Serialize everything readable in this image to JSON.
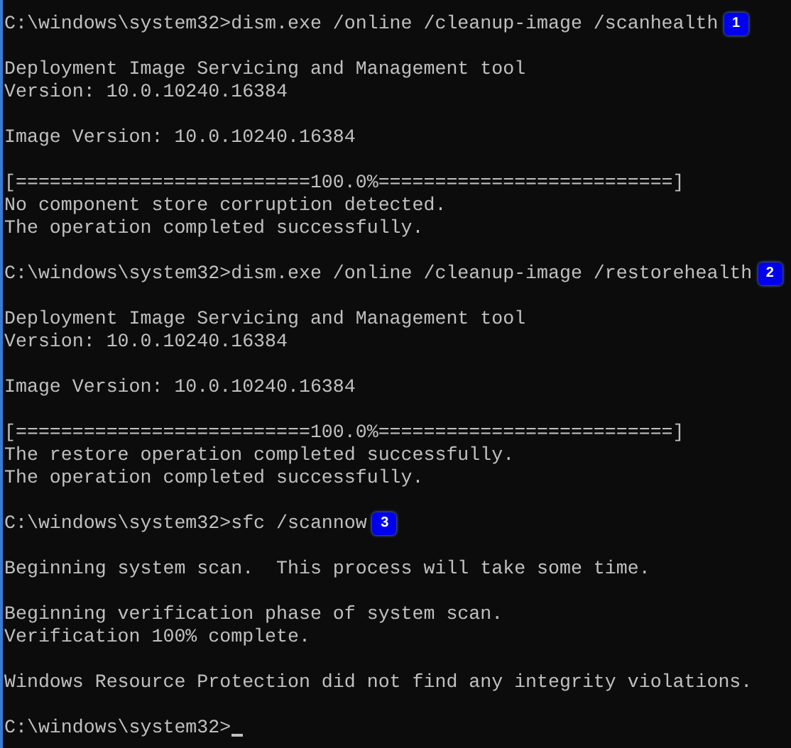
{
  "console": {
    "lines": [
      {
        "kind": "command",
        "text": "C:\\windows\\system32>dism.exe /online /cleanup-image /scanhealth",
        "badge": "1"
      },
      {
        "kind": "blank"
      },
      {
        "kind": "output",
        "text": "Deployment Image Servicing and Management tool"
      },
      {
        "kind": "output",
        "text": "Version: 10.0.10240.16384"
      },
      {
        "kind": "blank"
      },
      {
        "kind": "output",
        "text": "Image Version: 10.0.10240.16384"
      },
      {
        "kind": "blank"
      },
      {
        "kind": "output",
        "text": "[==========================100.0%==========================]"
      },
      {
        "kind": "output",
        "text": "No component store corruption detected."
      },
      {
        "kind": "output",
        "text": "The operation completed successfully."
      },
      {
        "kind": "blank"
      },
      {
        "kind": "command",
        "text": "C:\\windows\\system32>dism.exe /online /cleanup-image /restorehealth",
        "badge": "2"
      },
      {
        "kind": "blank"
      },
      {
        "kind": "output",
        "text": "Deployment Image Servicing and Management tool"
      },
      {
        "kind": "output",
        "text": "Version: 10.0.10240.16384"
      },
      {
        "kind": "blank"
      },
      {
        "kind": "output",
        "text": "Image Version: 10.0.10240.16384"
      },
      {
        "kind": "blank"
      },
      {
        "kind": "output",
        "text": "[==========================100.0%==========================]"
      },
      {
        "kind": "output",
        "text": "The restore operation completed successfully."
      },
      {
        "kind": "output",
        "text": "The operation completed successfully."
      },
      {
        "kind": "blank"
      },
      {
        "kind": "command",
        "text": "C:\\windows\\system32>sfc /scannow",
        "badge": "3"
      },
      {
        "kind": "blank"
      },
      {
        "kind": "output",
        "text": "Beginning system scan.  This process will take some time."
      },
      {
        "kind": "blank"
      },
      {
        "kind": "output",
        "text": "Beginning verification phase of system scan."
      },
      {
        "kind": "output",
        "text": "Verification 100% complete."
      },
      {
        "kind": "blank"
      },
      {
        "kind": "output",
        "text": "Windows Resource Protection did not find any integrity violations."
      },
      {
        "kind": "blank"
      },
      {
        "kind": "command",
        "text": "C:\\windows\\system32>",
        "cursor": true
      }
    ]
  }
}
